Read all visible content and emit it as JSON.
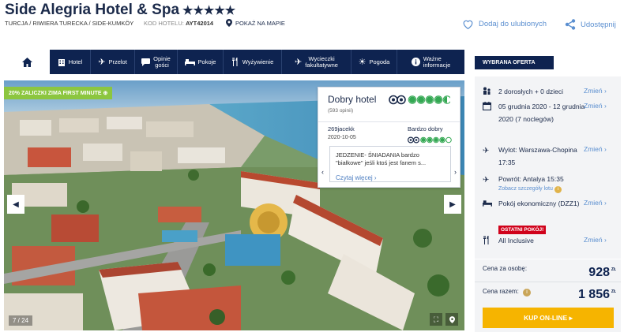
{
  "header": {
    "hotel_name": "Side Alegria Hotel & Spa",
    "stars": "★★★★★",
    "breadcrumb": "TURCJA / RIWIERA TURECKA / SIDE-KUMKÖY",
    "hotel_code_label": "KOD HOTELU:",
    "hotel_code": "AYT42014",
    "map_label": "POKAŻ NA MAPIE",
    "favorite_label": "Dodaj do ulubionych",
    "share_label": "Udostępnij"
  },
  "tabs": [
    {
      "label": "",
      "icon": "home-icon"
    },
    {
      "label": "Hotel",
      "icon": "hotel-icon"
    },
    {
      "label": "Przelot",
      "icon": "plane-icon"
    },
    {
      "label": "Opinie\ngości",
      "icon": "chat-icon"
    },
    {
      "label": "Pokoje",
      "icon": "bed-icon"
    },
    {
      "label": "Wyżywienie",
      "icon": "cutlery-icon"
    },
    {
      "label": "Wycieczki\nfakultatywne",
      "icon": "excursion-plane-icon"
    },
    {
      "label": "Pogoda",
      "icon": "sun-icon"
    },
    {
      "label": "Ważne\ninformacje",
      "icon": "info-icon"
    }
  ],
  "gallery": {
    "promo_label": "20% ZALICZKI ZIMA FIRST MINUTE",
    "counter": "7 / 24"
  },
  "review": {
    "title": "Dobry hotel",
    "count": "(593 opinii)",
    "rating_circles": 4.5,
    "user": "269jacekk",
    "date": "2020-10-05",
    "verdict": "Bardzo dobry",
    "user_rating_circles": 4,
    "text": "JEDZENIE- ŚNIADANIA bardzo \"białkowe\" jeśli ktoś jest fanem s...",
    "more_label": "Czytaj więcej"
  },
  "offer": {
    "header": "WYBRANA OFERTA",
    "change_label": "Zmień",
    "guests": "2 dorosłych + 0 dzieci",
    "dates": "05 grudnia 2020 - 12 grudnia 2020 (7 noclegów)",
    "departure": "Wylot: Warszawa-Chopina 17:35",
    "return": "Powrót: Antalya 15:35",
    "flight_details": "Zobacz szczegóły lotu",
    "room": "Pokój ekonomiczny (DZZ1)",
    "room_badge": "OSTATNI POKÓJ!",
    "board": "All Inclusive",
    "price_per_person_label": "Cena za osobę:",
    "price_per_person": "928",
    "price_total_label": "Cena razem:",
    "price_total": "1 856",
    "currency": "ZŁ",
    "buy_label": "KUP ON-LINE ▸"
  },
  "colors": {
    "navy": "#0e2350",
    "link": "#5b8fd0",
    "promo_green": "#8cc63f",
    "tripadvisor_green": "#34a853",
    "buy_orange": "#f6b400",
    "badge_red": "#d0021b"
  }
}
